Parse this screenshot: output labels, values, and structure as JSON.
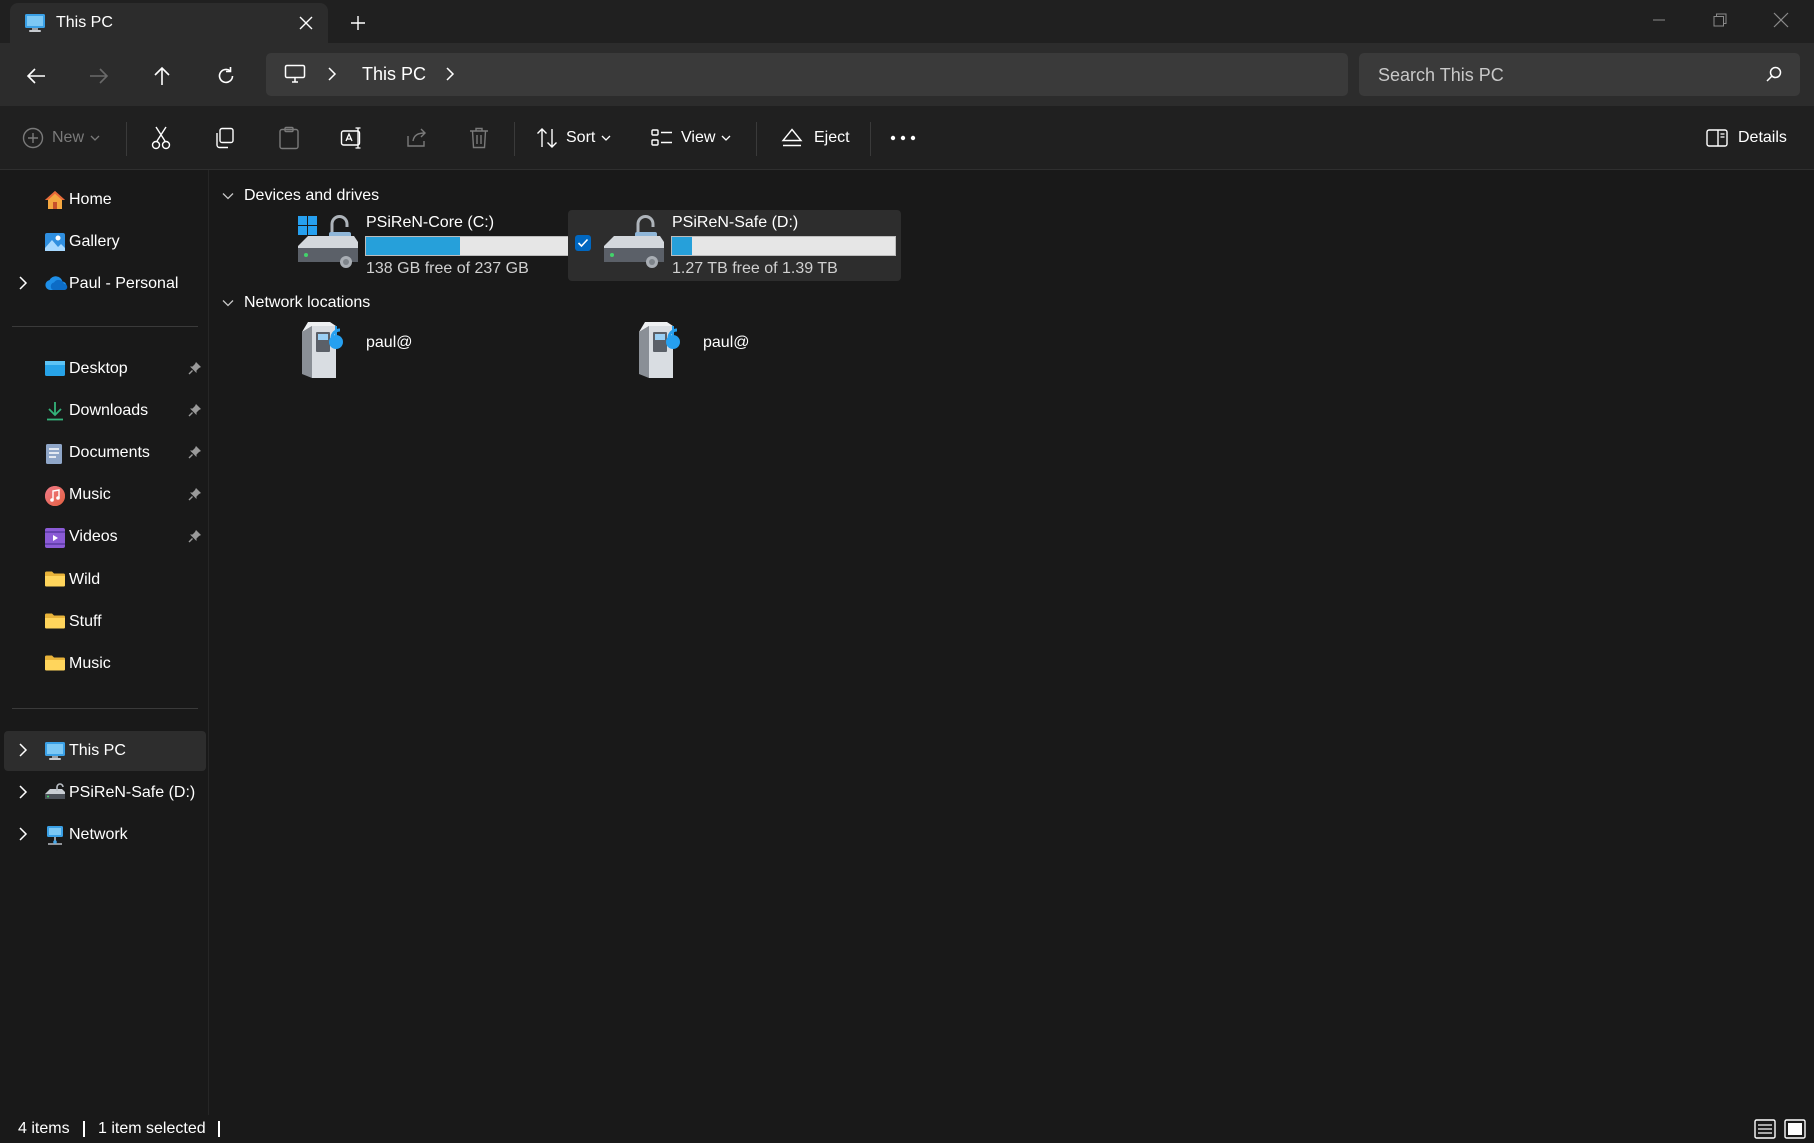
{
  "window": {
    "tab_title": "This PC",
    "accent": "#0067c0"
  },
  "nav": {
    "breadcrumb": "This PC",
    "search_placeholder": "Search This PC"
  },
  "commands": {
    "new": "New",
    "sort": "Sort",
    "view": "View",
    "eject": "Eject",
    "details": "Details"
  },
  "sidebar": {
    "top": [
      {
        "label": "Home",
        "icon": "home-icon"
      },
      {
        "label": "Gallery",
        "icon": "gallery-icon"
      },
      {
        "label": "Paul - Personal",
        "icon": "onedrive-icon"
      }
    ],
    "pinned": [
      {
        "label": "Desktop",
        "icon": "desktop-folder-icon",
        "pinned": true
      },
      {
        "label": "Downloads",
        "icon": "downloads-icon",
        "pinned": true
      },
      {
        "label": "Documents",
        "icon": "documents-icon",
        "pinned": true
      },
      {
        "label": "Music",
        "icon": "music-icon",
        "pinned": true
      },
      {
        "label": "Videos",
        "icon": "videos-icon",
        "pinned": true
      },
      {
        "label": "Wild",
        "icon": "folder-icon",
        "pinned": false
      },
      {
        "label": "Stuff",
        "icon": "folder-icon",
        "pinned": false
      },
      {
        "label": "Music",
        "icon": "folder-icon",
        "pinned": false
      }
    ],
    "bottom": [
      {
        "label": "This PC",
        "icon": "this-pc-icon",
        "selected": true
      },
      {
        "label": "PSiReN-Safe (D:)",
        "icon": "drive-icon",
        "selected": false
      },
      {
        "label": "Network",
        "icon": "network-icon",
        "selected": false
      }
    ]
  },
  "groups": {
    "devices": "Devices and drives",
    "network": "Network locations"
  },
  "drives": [
    {
      "name": "PSiReN-Core (C:)",
      "free": "138 GB free of 237 GB",
      "used_fraction": 0.42,
      "selected": false
    },
    {
      "name": "PSiReN-Safe (D:)",
      "free": "1.27 TB free of 1.39 TB",
      "used_fraction": 0.09,
      "selected": true
    }
  ],
  "network_locations": [
    {
      "label": "paul@"
    },
    {
      "label": "paul@"
    }
  ],
  "status": {
    "items": "4 items",
    "selected": "1 item selected"
  }
}
